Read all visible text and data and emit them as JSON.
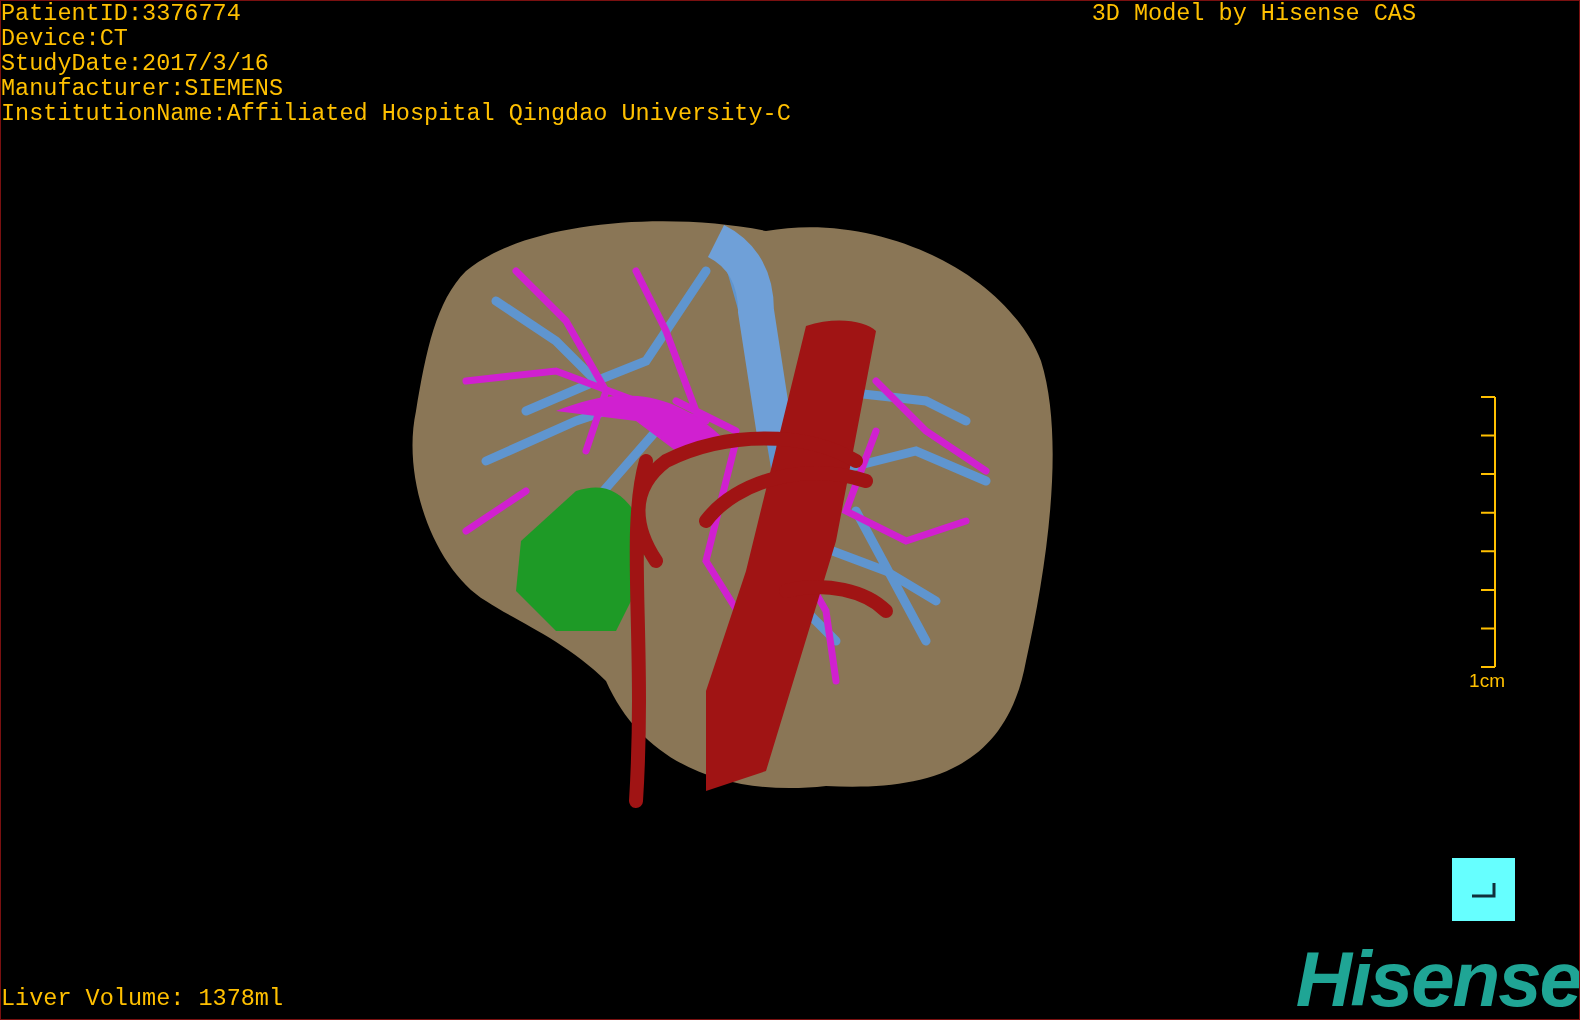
{
  "header": {
    "info_lines": [
      "PatientID:3376774",
      "Device:CT",
      "StudyDate:2017/3/16",
      "Manufacturer:SIEMENS",
      "InstitutionName:Affiliated Hospital Qingdao University-C"
    ],
    "title": "3D Model by Hisense CAS"
  },
  "scale_bar": {
    "label": "1cm"
  },
  "volume": "Liver Volume: 1378ml",
  "logo": "Hisense"
}
